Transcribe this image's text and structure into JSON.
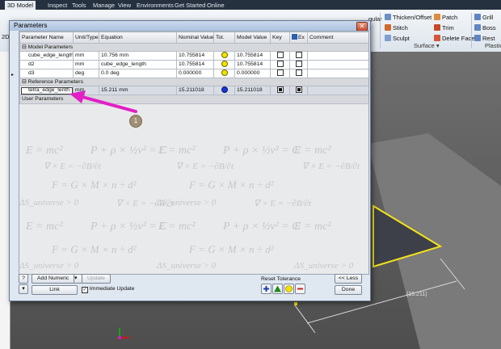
{
  "ribbon": {
    "tabs": [
      "3D Model",
      "Inspect",
      "Tools",
      "Manage",
      "View",
      "Environments",
      "Get Started",
      "Online"
    ],
    "commands": {
      "thicken_offset": "Thicken/Offset",
      "stitch": "Stitch",
      "sculpt": "Sculpt",
      "patch": "Patch",
      "trim": "Trim",
      "delete_face": "Delete Face",
      "grill": "Grill",
      "boss": "Boss",
      "rest": "Rest",
      "gular": "gular",
      "surface_group": "Surface ▾",
      "plastic_group": "Plastic"
    },
    "left_indicator": "2D"
  },
  "dialog": {
    "title": "Parameters",
    "close_glyph": "✕",
    "columns": [
      "Parameter Name",
      "Unit/Type",
      "Equation",
      "Nominal Value",
      "Tol.",
      "Model Value",
      "Key",
      "Ex",
      "Comment"
    ],
    "groups": {
      "model": "Model Parameters",
      "reference": "Reference Parameters",
      "user": "User Parameters"
    },
    "model_params": [
      {
        "name": "cube_edge_length",
        "unit": "mm",
        "equation": "10.756 mm",
        "nominal": "10.755814",
        "model": "10.755814"
      },
      {
        "name": "d2",
        "unit": "mm",
        "equation": "cube_edge_length",
        "nominal": "10.755814",
        "model": "10.755814"
      },
      {
        "name": "d3",
        "unit": "deg",
        "equation": "0.0 deg",
        "nominal": "0.000000",
        "model": "0.000000"
      }
    ],
    "reference_params": [
      {
        "name": "tetra_edge_lenth",
        "unit": "mm",
        "equation": "15.211 mm",
        "nominal": "15.211018",
        "model": "15.211018"
      }
    ],
    "watermark": [
      "E = mc²",
      "P + ρ × ½v² = C",
      "∇ × E = −∂B/∂t",
      "F = G × M × n ÷ d²",
      "ΔS_universe > 0",
      "∮_sphere > 0"
    ],
    "buttons": {
      "help": "?",
      "add_numeric": "Add Numeric",
      "update": "Update",
      "link": "Link",
      "immediate_update": "Immediate Update",
      "reset_tolerance": "Reset Tolerance",
      "less": "<< Less",
      "done": "Done"
    }
  },
  "annotation": {
    "badge": "1"
  },
  "model": {
    "dimension": "(15.211)"
  },
  "colors": {
    "arrow": "#e21fc6",
    "edge_highlight": "#f2e21a",
    "tol_yellow": "#f5e100",
    "tol_blue": "#1836d8"
  }
}
